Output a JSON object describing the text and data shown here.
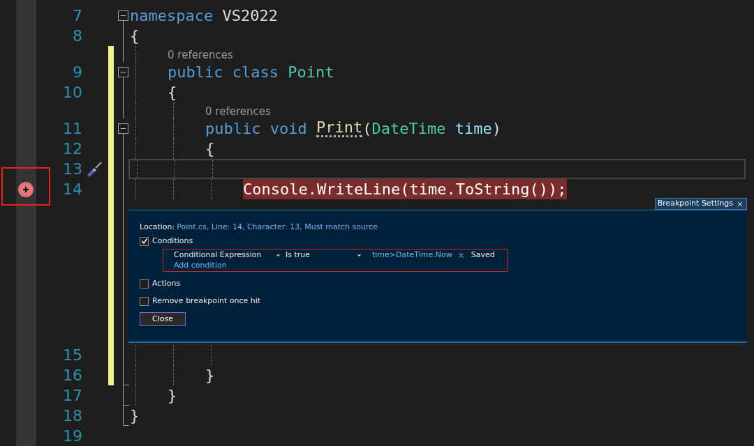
{
  "editor": {
    "rows": [
      {
        "kind": "code",
        "number": "7",
        "changed": false,
        "current": false,
        "fold_start": true,
        "fold_line": true,
        "fold_end": false,
        "tokens": [
          {
            "text": "namespace ",
            "kind": "keyword"
          },
          {
            "text": "VS2022",
            "kind": "plain"
          }
        ]
      },
      {
        "kind": "code",
        "number": "8",
        "changed": false,
        "current": false,
        "fold_start": false,
        "fold_line": true,
        "fold_end": false,
        "tokens": [
          {
            "text": "{",
            "kind": "plain"
          }
        ]
      },
      {
        "kind": "lens",
        "changed": true,
        "fold_start": false,
        "fold_line": true,
        "fold_end": false,
        "text": "    0 references"
      },
      {
        "kind": "code",
        "number": "9",
        "changed": true,
        "current": false,
        "fold_start": true,
        "fold_line": true,
        "fold_end": false,
        "tokens": [
          {
            "text": "    public ",
            "kind": "keyword"
          },
          {
            "text": "class ",
            "kind": "keyword"
          },
          {
            "text": "Point",
            "kind": "type"
          }
        ]
      },
      {
        "kind": "code",
        "number": "10",
        "changed": true,
        "current": false,
        "fold_start": false,
        "fold_line": true,
        "fold_end": false,
        "tokens": [
          {
            "text": "    {",
            "kind": "plain"
          }
        ]
      },
      {
        "kind": "lens",
        "changed": true,
        "fold_start": false,
        "fold_line": true,
        "fold_end": false,
        "text": "        0 references"
      },
      {
        "kind": "code",
        "number": "11",
        "changed": true,
        "current": false,
        "fold_start": true,
        "fold_line": true,
        "fold_end": false,
        "tokens": [
          {
            "text": "        public ",
            "kind": "keyword"
          },
          {
            "text": "void ",
            "kind": "keyword"
          },
          {
            "text": "Print",
            "kind": "method",
            "suggestion": true
          },
          {
            "text": "(",
            "kind": "plain"
          },
          {
            "text": "DateTime ",
            "kind": "type"
          },
          {
            "text": "time",
            "kind": "param"
          },
          {
            "text": ")",
            "kind": "plain"
          }
        ]
      },
      {
        "kind": "code",
        "number": "12",
        "changed": true,
        "current": false,
        "fold_start": false,
        "fold_line": true,
        "fold_end": false,
        "tokens": [
          {
            "text": "        {",
            "kind": "plain"
          }
        ]
      },
      {
        "kind": "code",
        "number": "13",
        "changed": true,
        "current": true,
        "quick_actions": true,
        "fold_start": false,
        "fold_line": true,
        "fold_end": false,
        "tokens": []
      },
      {
        "kind": "code",
        "number": "14",
        "changed": true,
        "current": false,
        "breakpoint": true,
        "annotated": true,
        "fold_start": false,
        "fold_line": true,
        "fold_end": false,
        "tokens": [
          {
            "text": "            Console.WriteLine(time.ToString());",
            "kind": "plain"
          }
        ]
      },
      {
        "kind": "panel",
        "changed": true,
        "fold_start": false,
        "fold_line": true,
        "fold_end": false
      },
      {
        "kind": "code",
        "number": "15",
        "changed": true,
        "current": false,
        "fold_start": false,
        "fold_line": true,
        "fold_end": false,
        "tokens": []
      },
      {
        "kind": "code",
        "number": "16",
        "changed": true,
        "current": false,
        "fold_start": false,
        "fold_line": true,
        "fold_end": true,
        "tokens": [
          {
            "text": "        }",
            "kind": "plain"
          }
        ]
      },
      {
        "kind": "code",
        "number": "17",
        "changed": false,
        "current": false,
        "fold_start": false,
        "fold_line": true,
        "fold_end": true,
        "tokens": [
          {
            "text": "    }",
            "kind": "plain"
          }
        ]
      },
      {
        "kind": "code",
        "number": "18",
        "changed": false,
        "current": false,
        "fold_start": false,
        "fold_line": true,
        "fold_end": true,
        "tokens": [
          {
            "text": "}",
            "kind": "plain"
          }
        ]
      },
      {
        "kind": "code",
        "number": "19",
        "changed": false,
        "current": false,
        "fold_start": false,
        "fold_line": false,
        "fold_end": false,
        "tokens": []
      }
    ]
  },
  "breakpoint_settings": {
    "tab_title": "Breakpoint Settings",
    "location_label": "Location:",
    "location": "Point.cs, Line: 14, Character: 13, Must match source",
    "conditions": {
      "label": "Conditions",
      "checked": true,
      "annotated": true,
      "type": "Conditional Expression",
      "mode": "Is true",
      "expression": "time>DateTime.Now",
      "status": "Saved",
      "add_label": "Add condition"
    },
    "options": [
      {
        "label": "Actions",
        "checked": false
      },
      {
        "label": "Remove breakpoint once hit",
        "checked": false
      }
    ],
    "close_button": "Close"
  }
}
